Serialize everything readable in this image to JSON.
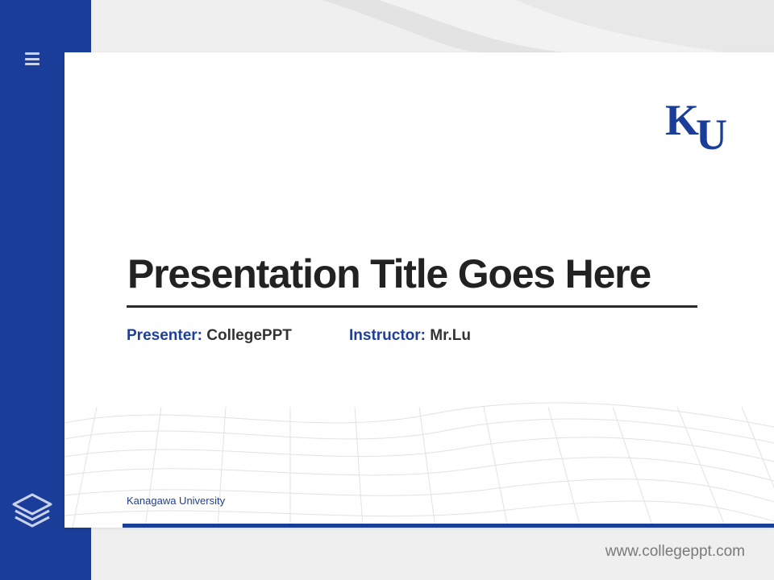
{
  "slide": {
    "title": "Presentation Title Goes Here",
    "presenter_label": "Presenter:",
    "presenter_name": "CollegePPT",
    "instructor_label": "Instructor:",
    "instructor_name": "Mr.Lu",
    "university": "Kanagawa University",
    "logo_text": "KU"
  },
  "footer": {
    "url": "www.collegeppt.com"
  },
  "icons": {
    "menu": "menu-icon",
    "layers": "layers-icon"
  },
  "colors": {
    "brand_blue": "#1a3d99",
    "title_text": "#222222",
    "label_blue": "#1f3f95",
    "url_gray": "#7a7a7a"
  }
}
